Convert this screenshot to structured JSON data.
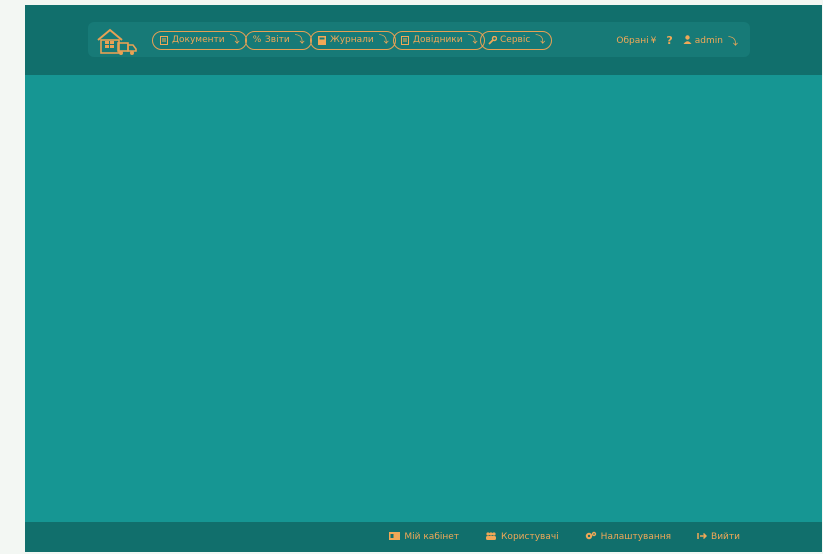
{
  "nav": {
    "menus": [
      {
        "label": "Документи",
        "icon": "file-icon"
      },
      {
        "label": "Звіти",
        "icon": "percent-icon"
      },
      {
        "label": "Журнали",
        "icon": "book-icon"
      },
      {
        "label": "Довідники",
        "icon": "file-icon"
      },
      {
        "label": "Сервіс",
        "icon": "wrench-icon"
      }
    ],
    "favorites_label": "Обрані",
    "help_label": "?",
    "user_label": "admin"
  },
  "footer": {
    "cabinet_label": "Мій кабінет",
    "users_label": "Користувачі",
    "settings_label": "Налаштування",
    "logout_label": "Вийти"
  },
  "colors": {
    "accent": "#f0a857",
    "header_bg": "#116f6c",
    "content_bg": "#169693"
  }
}
